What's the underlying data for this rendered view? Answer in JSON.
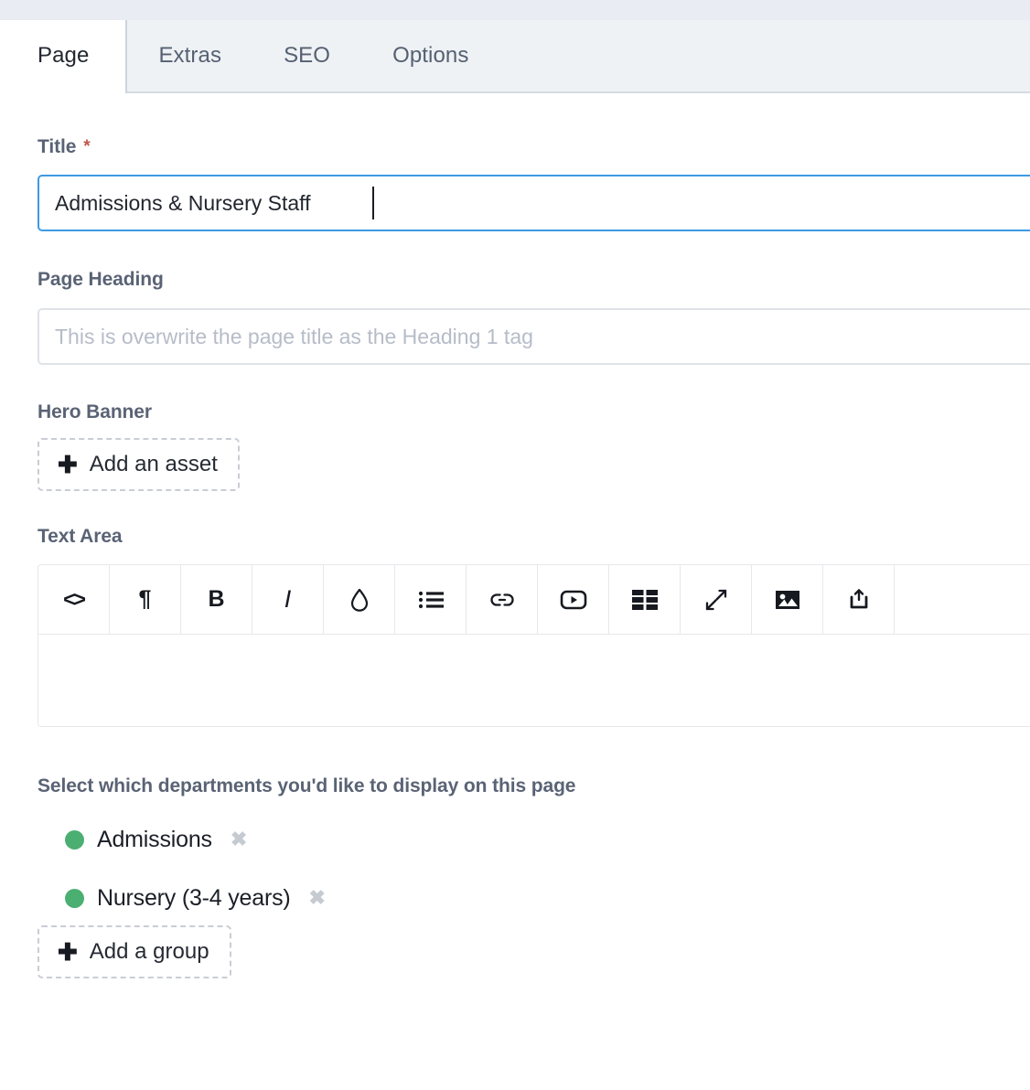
{
  "tabs": [
    {
      "label": "Page",
      "active": true
    },
    {
      "label": "Extras",
      "active": false
    },
    {
      "label": "SEO",
      "active": false
    },
    {
      "label": "Options",
      "active": false
    }
  ],
  "fields": {
    "title": {
      "label": "Title",
      "required_marker": "*",
      "value": "Admissions & Nursery Staff",
      "placeholder": ""
    },
    "page_heading": {
      "label": "Page Heading",
      "value": "",
      "placeholder": "This is overwrite the page title as the Heading 1 tag"
    },
    "hero_banner": {
      "label": "Hero Banner",
      "add_button": "Add an asset",
      "add_icon": "plus-icon"
    },
    "text_area": {
      "label": "Text Area",
      "content": "",
      "toolbar": [
        {
          "name": "code-icon",
          "glyph": "<>"
        },
        {
          "name": "paragraph-icon",
          "glyph": "¶"
        },
        {
          "name": "bold-icon",
          "glyph": "B"
        },
        {
          "name": "italic-icon",
          "glyph": "I"
        },
        {
          "name": "droplet-icon",
          "glyph": ""
        },
        {
          "name": "bullet-list-icon",
          "glyph": ""
        },
        {
          "name": "link-icon",
          "glyph": ""
        },
        {
          "name": "video-icon",
          "glyph": ""
        },
        {
          "name": "table-icon",
          "glyph": ""
        },
        {
          "name": "expand-icon",
          "glyph": ""
        },
        {
          "name": "image-icon",
          "glyph": ""
        },
        {
          "name": "upload-icon",
          "glyph": ""
        }
      ]
    },
    "departments": {
      "label": "Select which departments you'd like to display on this page",
      "items": [
        {
          "label": "Admissions",
          "status_color": "#4caf72",
          "remove_icon": "close-icon"
        },
        {
          "label": "Nursery (3-4 years)",
          "status_color": "#4caf72",
          "remove_icon": "close-icon"
        }
      ],
      "add_button": "Add a group",
      "add_icon": "plus-icon"
    }
  },
  "colors": {
    "focus_border": "#3d9ae3",
    "required_star": "#c0584a",
    "status_green": "#4caf72",
    "label_text": "#5a6375",
    "tabbar_bg": "#eef2f5"
  }
}
